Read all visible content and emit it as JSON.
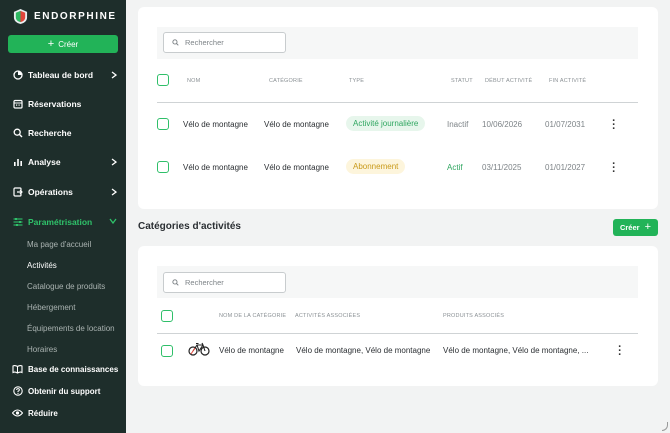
{
  "app": {
    "brand": "ENDORPHINE"
  },
  "sidebar": {
    "create_label": "Créer",
    "items": [
      {
        "label": "Tableau de bord",
        "icon": "dashboard-icon",
        "has_chevron": true
      },
      {
        "label": "Réservations",
        "icon": "calendar-icon",
        "has_chevron": false
      },
      {
        "label": "Recherche",
        "icon": "search-icon",
        "has_chevron": false
      },
      {
        "label": "Analyse",
        "icon": "bar-chart-icon",
        "has_chevron": true
      },
      {
        "label": "Opérations",
        "icon": "operations-icon",
        "has_chevron": true
      },
      {
        "label": "Paramétrisation",
        "icon": "sliders-icon",
        "has_chevron": true,
        "active": true
      }
    ],
    "subitems": [
      {
        "label": "Ma page d'accueil"
      },
      {
        "label": "Activités",
        "current": true
      },
      {
        "label": "Catalogue de produits"
      },
      {
        "label": "Hébergement"
      },
      {
        "label": "Équipements de location"
      },
      {
        "label": "Horaires"
      }
    ],
    "bottom": [
      {
        "label": "Base de connaissances",
        "icon": "book-icon"
      },
      {
        "label": "Obtenir du support",
        "icon": "help-icon"
      },
      {
        "label": "Réduire",
        "icon": "eye-icon"
      }
    ],
    "accent": "#2fc26a",
    "bg": "#1e2e2b"
  },
  "activities": {
    "search_placeholder": "Rechercher",
    "columns": [
      "NOM",
      "CATÉGORIE",
      "TYPE",
      "STATUT",
      "DÉBUT ACTIVITÉ",
      "FIN ACTIVITÉ"
    ],
    "rows": [
      {
        "name": "Vélo de montagne",
        "category": "Vélo de montagne",
        "type": "Activité journalière",
        "type_color": "green",
        "status": "Inactif",
        "start": "10/06/2026",
        "end": "01/07/2031"
      },
      {
        "name": "Vélo de montagne",
        "category": "Vélo de montagne",
        "type": "Abonnement",
        "type_color": "yellow",
        "status": "Actif",
        "start": "03/11/2025",
        "end": "01/01/2027"
      }
    ]
  },
  "categories": {
    "title": "Catégories d'activités",
    "create_label": "Créer",
    "search_placeholder": "Rechercher",
    "columns": [
      "NOM DE LA CATÉGORIE",
      "ACTIVITÉS ASSOCIÉES",
      "PRODUITS ASSOCIÉS"
    ],
    "rows": [
      {
        "icon": "bike-icon",
        "name": "Vélo de montagne",
        "activities": "Vélo de montagne, Vélo de montagne",
        "products": "Vélo de montagne, Vélo de montagne, ..."
      }
    ]
  }
}
